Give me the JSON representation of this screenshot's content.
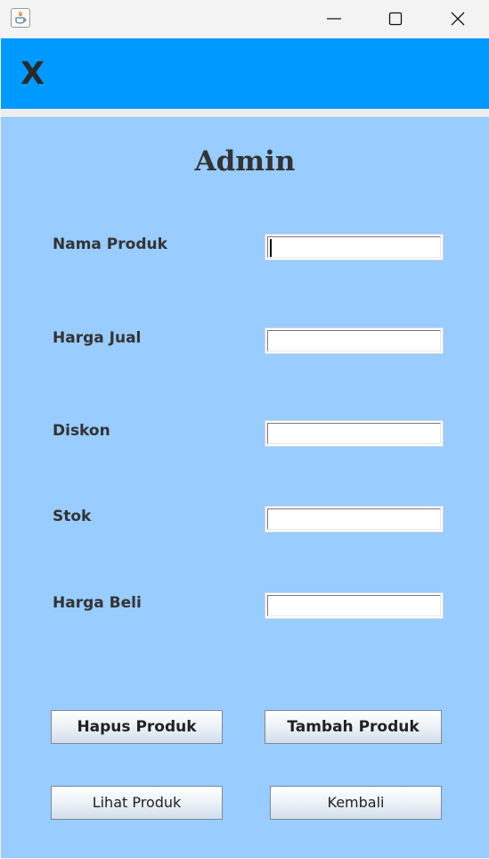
{
  "window": {
    "app_icon": "java-icon",
    "controls": [
      "minimize-icon",
      "maximize-icon",
      "close-icon"
    ]
  },
  "header": {
    "text": "X",
    "color": "#0099ff"
  },
  "form": {
    "title": "Admin",
    "background": "#99ccff",
    "fields": [
      {
        "label": "Nama Produk",
        "value": "",
        "focused": true
      },
      {
        "label": "Harga Jual",
        "value": ""
      },
      {
        "label": "Diskon",
        "value": ""
      },
      {
        "label": "Stok",
        "value": ""
      },
      {
        "label": "Harga Beli",
        "value": ""
      }
    ]
  },
  "buttons": {
    "hapus": "Hapus Produk",
    "tambah": "Tambah Produk",
    "lihat": "Lihat Produk",
    "kembali": "Kembali"
  }
}
